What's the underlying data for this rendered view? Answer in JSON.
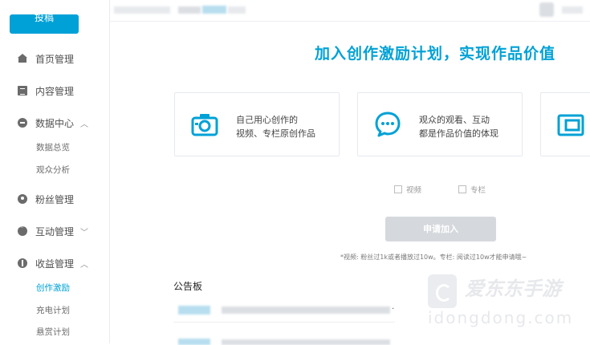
{
  "sidebar": {
    "post_button": "投稿",
    "items": [
      {
        "label": "首页管理",
        "icon": "home-icon"
      },
      {
        "label": "内容管理",
        "icon": "document-icon"
      },
      {
        "label": "数据中心",
        "icon": "data-icon",
        "chevron": "^"
      },
      {
        "label": "粉丝管理",
        "icon": "fans-icon"
      },
      {
        "label": "互动管理",
        "icon": "comment-icon",
        "chevron": "v"
      },
      {
        "label": "收益管理",
        "icon": "income-icon",
        "chevron": "^"
      }
    ],
    "data_sub": [
      "数据总览",
      "观众分析"
    ],
    "income_sub": [
      "创作激励",
      "充电计划",
      "悬赏计划"
    ]
  },
  "main": {
    "headline": "加入创作激励计划，实现作品价值",
    "cards": [
      {
        "line1": "自己用心创作的",
        "line2": "视频、专栏原创作品",
        "icon": "camera-icon"
      },
      {
        "line1": "观众的观看、互动",
        "line2": "都是作品价值的体现",
        "icon": "chat-bubble-icon"
      },
      {
        "line1": "",
        "line2": "",
        "icon": "wallet-icon"
      }
    ],
    "checkboxes": [
      "视频",
      "专栏"
    ],
    "apply_button": "申请加入",
    "note": "*视频: 粉丝过1k或者播放过10w。专栏: 阅读过10w才能申请哦~",
    "board_title": "公告板",
    "board_first_row_end": "."
  },
  "colors": {
    "accent": "#00a1d6",
    "disabled": "#d5d8dc"
  },
  "watermark": {
    "text": "爱东东手游",
    "url": "idongdong.com"
  }
}
